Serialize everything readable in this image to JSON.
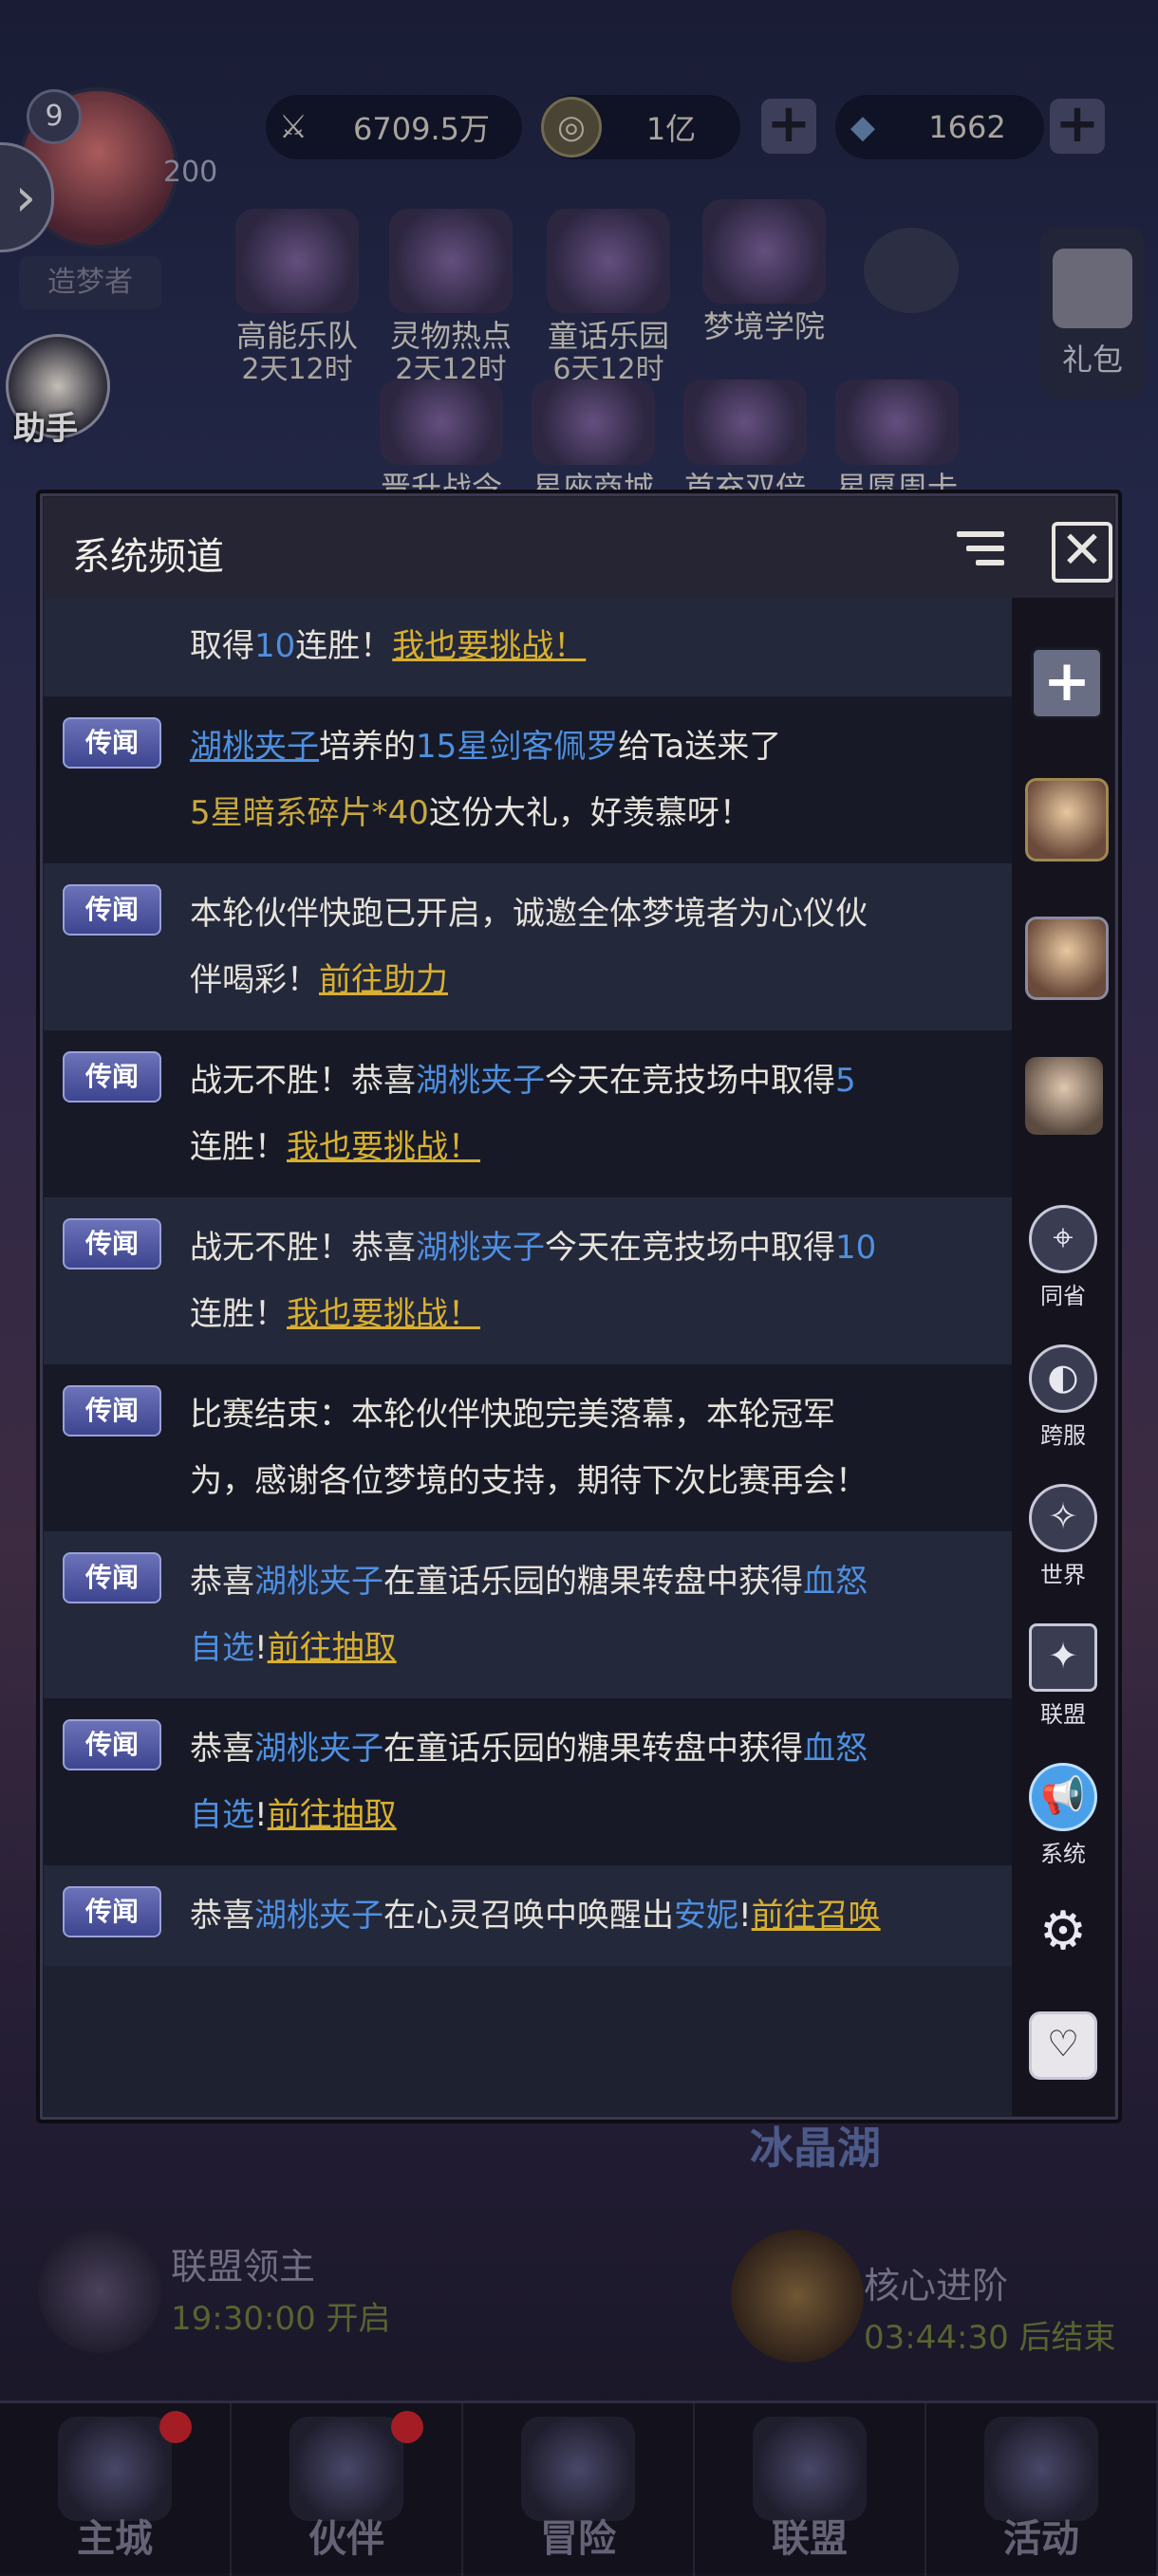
{
  "header": {
    "level": "9",
    "power": "200",
    "resources": [
      {
        "icon": "sword-icon",
        "value": "6709.5万"
      },
      {
        "icon": "coin-icon",
        "value": "1亿"
      },
      {
        "icon": "diamond-icon",
        "value": "1662"
      }
    ],
    "title_tag": "造梦者"
  },
  "features": [
    {
      "label": "高能乐队",
      "timer": "2天12时"
    },
    {
      "label": "灵物热点",
      "timer": "2天12时"
    },
    {
      "label": "童话乐园",
      "timer": "6天12时"
    },
    {
      "label": "梦境学院",
      "timer": ""
    }
  ],
  "features_row2": [
    "晋升战令",
    "星座商城",
    "首充双倍",
    "星愿周卡"
  ],
  "helper_label": "助手",
  "gift_label": "礼包",
  "panel": {
    "title": "系统频道",
    "tag_label": "传闻",
    "first_partial": {
      "text1": "取得",
      "num": "10",
      "text2": "连胜！",
      "link": "我也要挑战！"
    },
    "m1": {
      "name": "湖桃夹子",
      "t1": "培养的",
      "hero": "15星剑客佩罗",
      "t2": "给Ta送来了",
      "item": "5星暗系碎片*40",
      "t3": "这份大礼，好羡慕呀！"
    },
    "m2": {
      "t1": "本轮伙伴快跑已开启，诚邀全体梦境者为心仪伙伴喝彩！",
      "link": "前往助力"
    },
    "m3": {
      "t1": "战无不胜！恭喜",
      "name": "湖桃夹子",
      "t2": "今天在竞技场中取得",
      "num": "5",
      "t3": "连胜！",
      "link": "我也要挑战！"
    },
    "m4": {
      "t1": "战无不胜！恭喜",
      "name": "湖桃夹子",
      "t2": "今天在竞技场中取得",
      "num": "10",
      "t3": "连胜！",
      "link": "我也要挑战！"
    },
    "m5": {
      "t1": "比赛结束：本轮伙伴快跑完美落幕，本轮冠军为，感谢各位梦境的支持，期待下次比赛再会！"
    },
    "m6": {
      "t1": "恭喜",
      "name": "湖桃夹子",
      "t2": "在童话乐园的糖果转盘中获得",
      "item": "血怒自选",
      "t3": "!",
      "link": "前往抽取"
    },
    "m7": {
      "t1": "恭喜",
      "name": "湖桃夹子",
      "t2": "在童话乐园的糖果转盘中获得",
      "item": "血怒自选",
      "t3": "!",
      "link": "前往抽取"
    },
    "m8": {
      "t1": "恭喜",
      "name": "湖桃夹子",
      "t2": "在心灵召唤中唤醒出",
      "hero": "安妮",
      "t3": "!",
      "link": "前往召唤"
    }
  },
  "side_channels": [
    {
      "icon": "location-icon",
      "label": "同省"
    },
    {
      "icon": "cross-server-icon",
      "label": "跨服"
    },
    {
      "icon": "world-icon",
      "label": "世界"
    },
    {
      "icon": "alliance-icon",
      "label": "联盟"
    },
    {
      "icon": "megaphone-icon",
      "label": "系统"
    }
  ],
  "events": {
    "lake": "冰晶湖",
    "left": {
      "title": "联盟领主",
      "time": "19:30:00 开启"
    },
    "right": {
      "title": "核心进阶",
      "time": "03:44:30 后结束"
    }
  },
  "bottom_nav": [
    "主城",
    "伙伴",
    "冒险",
    "联盟",
    "活动"
  ]
}
